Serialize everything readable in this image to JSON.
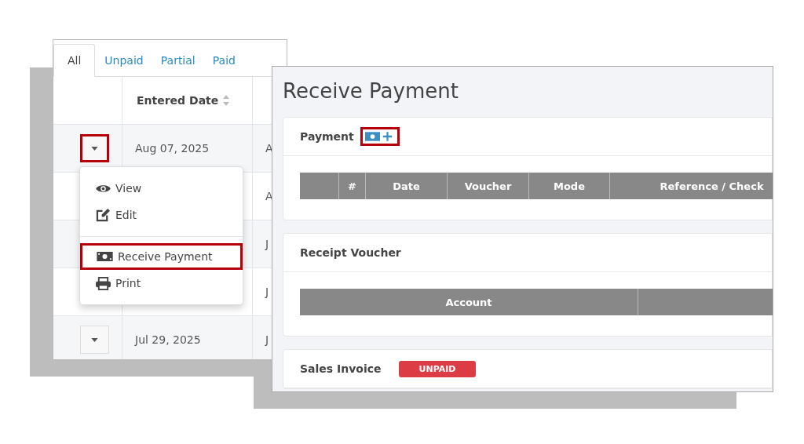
{
  "list_panel": {
    "tabs": [
      {
        "label": "All",
        "selected": true
      },
      {
        "label": "Unpaid",
        "selected": false
      },
      {
        "label": "Partial",
        "selected": false
      },
      {
        "label": "Paid",
        "selected": false
      }
    ],
    "columns": [
      {
        "label": "Entered Date",
        "sortable": true
      }
    ],
    "rows": [
      {
        "date": "Aug 07, 2025",
        "column_3": "A",
        "highlighted": true
      },
      {
        "column_3": "A"
      },
      {
        "column_3": "J"
      },
      {
        "column_3": "J"
      },
      {
        "date": "Jul 29, 2025",
        "column_3": "J",
        "highlighted": false
      }
    ],
    "menu": [
      {
        "label": "View",
        "divider_before": false,
        "highlighted": false
      },
      {
        "label": "Edit",
        "divider_before": false,
        "highlighted": false
      },
      {
        "label": "Receive Payment",
        "divider_before": true,
        "highlighted": true
      },
      {
        "label": "Print",
        "divider_before": false,
        "highlighted": false
      }
    ]
  },
  "payment_panel": {
    "title": "Receive Payment",
    "sections": [
      {
        "title": "Payment",
        "add_button": {
          "highlighted": true
        },
        "columns": [
          {
            "kind": "blank"
          },
          {
            "kind": "text",
            "label": "#"
          },
          {
            "kind": "text",
            "label": "Date"
          },
          {
            "kind": "text",
            "label": "Voucher"
          },
          {
            "kind": "text",
            "label": "Mode"
          },
          {
            "kind": "text",
            "label": "Reference / Check"
          }
        ]
      },
      {
        "title": "Receipt Voucher",
        "columns": [
          {
            "kind": "text",
            "label": "Account"
          },
          {
            "kind": "blank"
          }
        ]
      },
      {
        "title": "Sales Invoice",
        "badge": "UNPAID"
      }
    ]
  }
}
